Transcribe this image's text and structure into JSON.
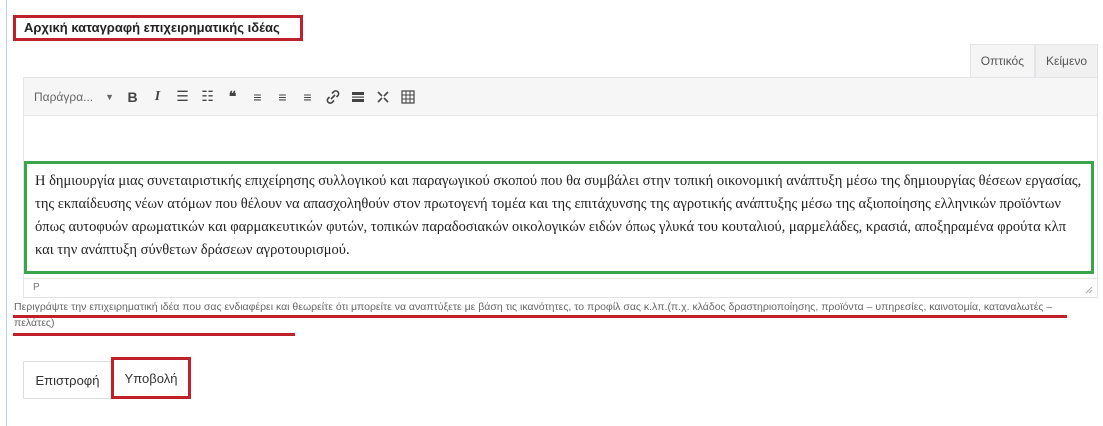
{
  "field": {
    "title": "Αρχική καταγραφή επιχειρηματικής ιδέας"
  },
  "editor": {
    "tabs": [
      {
        "label": "Οπτικός",
        "active": true
      },
      {
        "label": "Κείμενο",
        "active": false
      }
    ],
    "toolbar": {
      "format_select": "Παράγρα...",
      "buttons": [
        {
          "name": "bold-icon",
          "glyph": "B"
        },
        {
          "name": "italic-icon",
          "glyph": "I"
        },
        {
          "name": "bullet-list-icon",
          "glyph": "☰"
        },
        {
          "name": "numbered-list-icon",
          "glyph": "☷"
        },
        {
          "name": "blockquote-icon",
          "glyph": "❝"
        },
        {
          "name": "align-left-icon",
          "glyph": "≡"
        },
        {
          "name": "align-center-icon",
          "glyph": "≡"
        },
        {
          "name": "align-right-icon",
          "glyph": "≡"
        },
        {
          "name": "link-icon",
          "glyph": "🔗"
        },
        {
          "name": "read-more-icon",
          "glyph": "▬"
        },
        {
          "name": "fullscreen-icon",
          "glyph": "⤧"
        },
        {
          "name": "toolbar-toggle-icon",
          "glyph": "▦"
        }
      ]
    },
    "content": "Η δημιουργία μιας συνεταιριστικής επιχείρησης συλλογικού και παραγωγικού σκοπού που θα συμβάλει στην τοπική οικονομική ανάπτυξη μέσω της δημιουργίας θέσεων εργασίας, της εκπαίδευσης νέων ατόμων που θέλουν να απασχοληθούν στον πρωτογενή τομέα και της επιτάχυνσης της αγροτικής ανάπτυξης μέσω της αξιοποίησης ελληνικών προϊόντων όπως αυτοφυών αρωματικών και φαρμακευτικών φυτών, τοπικών παραδοσιακών οικολογικών ειδών όπως γλυκά του κουταλιού, μαρμελάδες, κρασιά, αποξηραμένα φρούτα κλπ και την ανάπτυξη σύνθετων δράσεων αγροτουρισμού.",
    "status_path": "P"
  },
  "hint": "Περιγράψτε την επιχειρηματική ιδέα που σας ενδιαφέρει και θεωρείτε ότι μπορείτε να αναπτύξετε με βάση τις ικανότητες, το προφίλ σας κ.λπ.(π.χ. κλάδος δραστηριοποίησης, προϊόντα – υπηρεσίες, καινοτομία, καταναλωτές – πελάτες)",
  "actions": {
    "back_label": "Επιστροφή",
    "submit_label": "Υποβολή"
  },
  "colors": {
    "highlight_red": "#c0202a",
    "highlight_green": "#3aa54b"
  }
}
